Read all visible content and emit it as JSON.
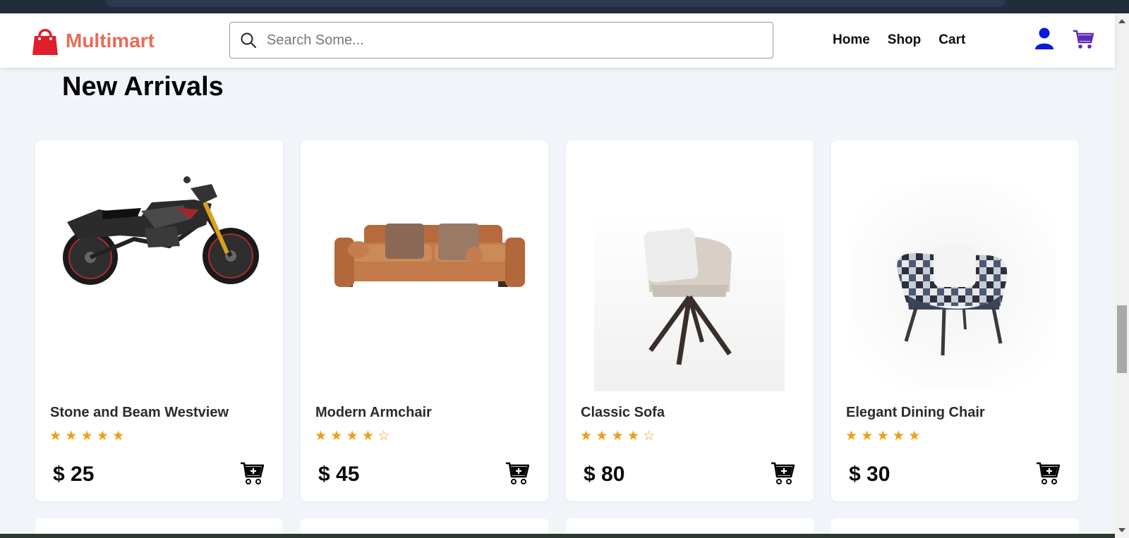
{
  "brand": {
    "name": "Multimart",
    "color": "#ea6b55"
  },
  "search": {
    "placeholder": "Search Some..."
  },
  "nav": {
    "links": [
      "Home",
      "Shop",
      "Cart"
    ]
  },
  "section": {
    "title": "New Arrivals"
  },
  "colors": {
    "star": "#f39c12",
    "user_icon": "#0a1ad8",
    "cart_icon": "#5b2bb5"
  },
  "products": [
    {
      "name": "Stone and Beam Westview",
      "stars": "★ ★ ★ ★ ★",
      "rating": 5,
      "price": "$ 25",
      "image_icon": "motorcycle-image"
    },
    {
      "name": "Modern Armchair",
      "stars": "★ ★ ★ ★ ☆",
      "rating": 4,
      "price": "$ 45",
      "image_icon": "sofa-image"
    },
    {
      "name": "Classic Sofa",
      "stars": "★ ★ ★ ★ ☆",
      "rating": 4,
      "price": "$ 80",
      "image_icon": "armchair-image"
    },
    {
      "name": "Elegant Dining Chair",
      "stars": "★ ★ ★ ★ ★",
      "rating": 5,
      "price": "$ 30",
      "image_icon": "patterned-chair-image"
    }
  ]
}
